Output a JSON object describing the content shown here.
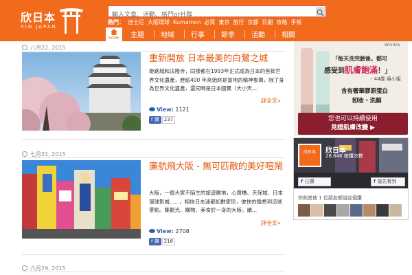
{
  "header": {
    "logo_text": "欣日本",
    "logo_sub": "XIN JAPAN",
    "search_placeholder": "輸入文章、活動、格鬥or社群",
    "hot_label": "熱門：",
    "hot_tags": [
      "迪士尼",
      "大阪環球",
      "Kumamon",
      "必買",
      "東京",
      "旅行",
      "京都",
      "日劇",
      "攻略",
      "手帳"
    ],
    "home_label": "HOME",
    "nav": [
      "主題",
      "地域",
      "行事",
      "節季",
      "活動",
      "相關"
    ]
  },
  "articles": [
    {
      "date": "八月22, 2015",
      "title": "重新開放 日本最美的白鷺之城",
      "excerpt": "姬路城和法隆寺，同樣都在1993年正式成為日本的首批世界文化遺產，歷紙400 年來始終是當地的精神象徵，除了身為世界文化遺產，還同時是日本國寶（大小天...",
      "more": "詳全文»",
      "views_label": "View",
      "views": "1121",
      "fb_label": "讚",
      "fb_count": "237"
    },
    {
      "date": "七月31, 2015",
      "title": "廉航飛大阪 - 無可匹敵的美好喧鬧",
      "excerpt": "大阪，一個大家不陌生的旅遊勝地，心齋橋、天保城、日本環球影城......，相信日本迷都如數家珍，彼快的聯想到這些景點。集觀光、購物、美食於一身的大阪，讓...",
      "more": "詳全文»",
      "views_label": "View",
      "views": "2708",
      "fb_label": "讚",
      "fb_count": "216"
    },
    {
      "date": "六月29, 2015"
    }
  ],
  "sidebar": {
    "ad": {
      "brand": "Wrinkle",
      "line1": "「每天洗完臉後，都可",
      "line2_a": "感受到",
      "line2_hl": "肌膚飽滿",
      "line2_b": "！」",
      "line3": "- 44歲 吳小姐",
      "line4": "含有奢華膠原蛋白",
      "line5": "卸妝・洗顏",
      "banner1": "您也可以持續使用",
      "banner2": "見證肌膚改變 ▶"
    },
    "fb_page": {
      "logo": "欣日本",
      "name": "欣日本",
      "likes": "28,648 按讚次數",
      "like_btn": "已讚",
      "share_btn": "搶先看到",
      "friends": "你和其他 1 位朋友都說這個讚"
    }
  },
  "colors": {
    "brand": "#f26a1b",
    "link": "#e35a12",
    "fb": "#4267b2"
  }
}
